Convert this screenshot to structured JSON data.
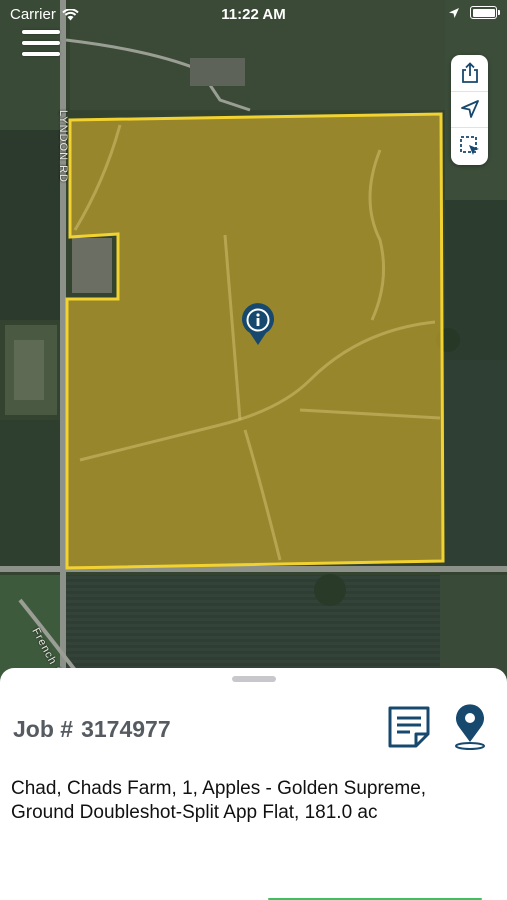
{
  "status_bar": {
    "carrier": "Carrier",
    "time": "11:22 AM"
  },
  "map": {
    "road_labels": [
      "LYNDON RD",
      "French C"
    ],
    "field_outline_color": "#f2d231",
    "field_fill_color": "#b39a2a",
    "controls": {
      "share_icon": "share-icon",
      "locate_icon": "location-arrow-icon",
      "select_icon": "select-area-icon"
    },
    "marker_icon": "info-marker-icon"
  },
  "job": {
    "label": "Job #",
    "number": "3174977",
    "description": "Chad, Chads Farm, 1, Apples - Golden Supreme, Ground Doubleshot-Split App Flat, 181.0 ac",
    "notes_icon": "notes-icon",
    "location_icon": "location-pin-icon"
  },
  "colors": {
    "brand_dark": "#17486e",
    "accent_green": "#3fbf5f"
  }
}
